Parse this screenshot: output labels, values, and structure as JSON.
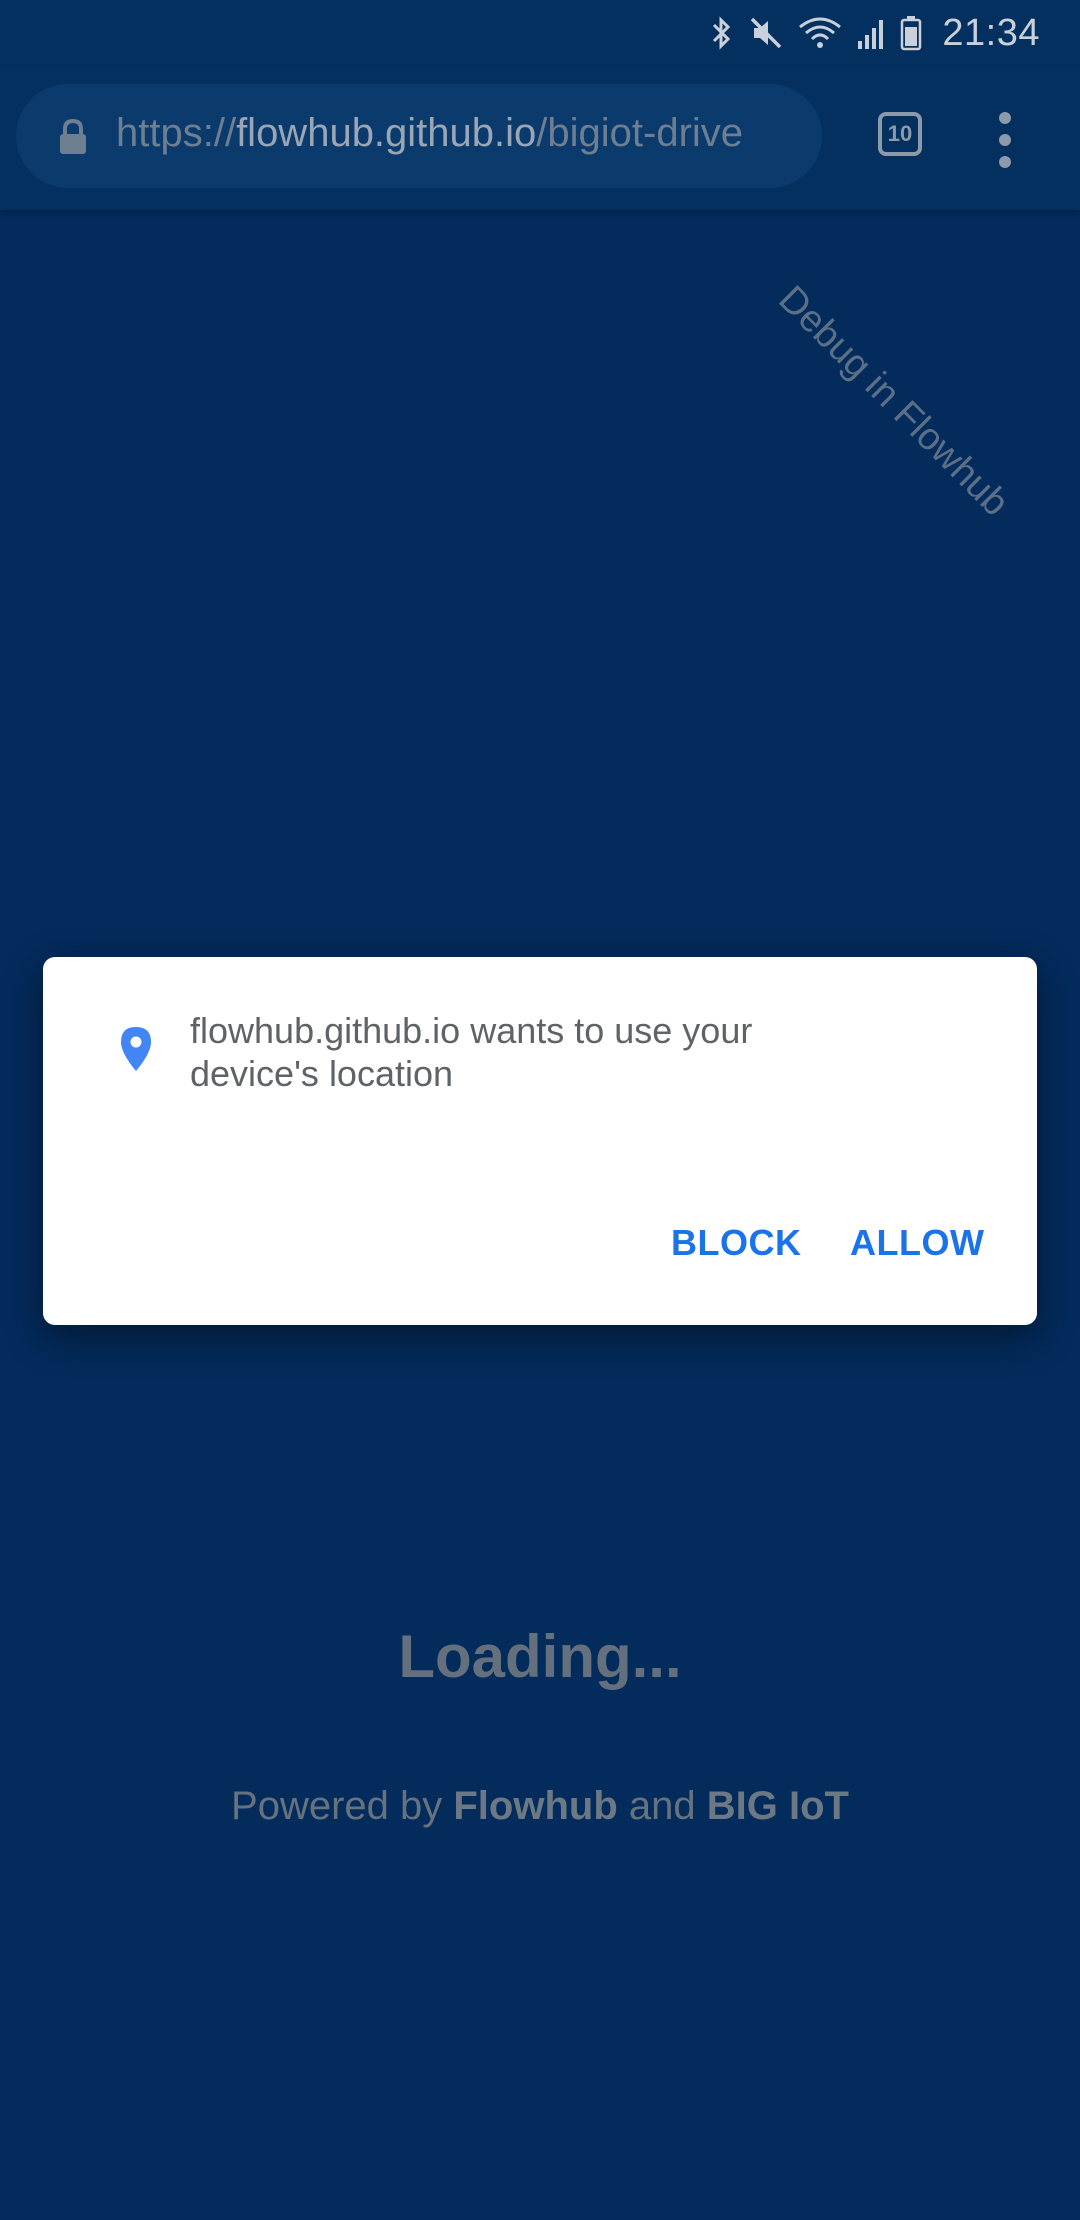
{
  "status_bar": {
    "time": "21:34",
    "icons": [
      "bluetooth-icon",
      "mute-icon",
      "wifi-icon",
      "signal-icon",
      "battery-icon"
    ]
  },
  "browser": {
    "url_scheme": "https://",
    "url_host": "flowhub.github.io",
    "url_path": "/bigiot-drive",
    "tab_count": "10"
  },
  "page": {
    "debug_link": "Debug in Flowhub",
    "loading": "Loading...",
    "powered_prefix": "Powered by ",
    "powered_flowhub": "Flowhub",
    "powered_and": " and ",
    "powered_bigiot": "BIG IoT"
  },
  "dialog": {
    "message": "flowhub.github.io wants to use your device's location",
    "block_label": "BLOCK",
    "allow_label": "ALLOW"
  },
  "colors": {
    "page_background": "#032b5c",
    "dialog_button": "#1a73e8",
    "location_pin": "#4285f4"
  }
}
